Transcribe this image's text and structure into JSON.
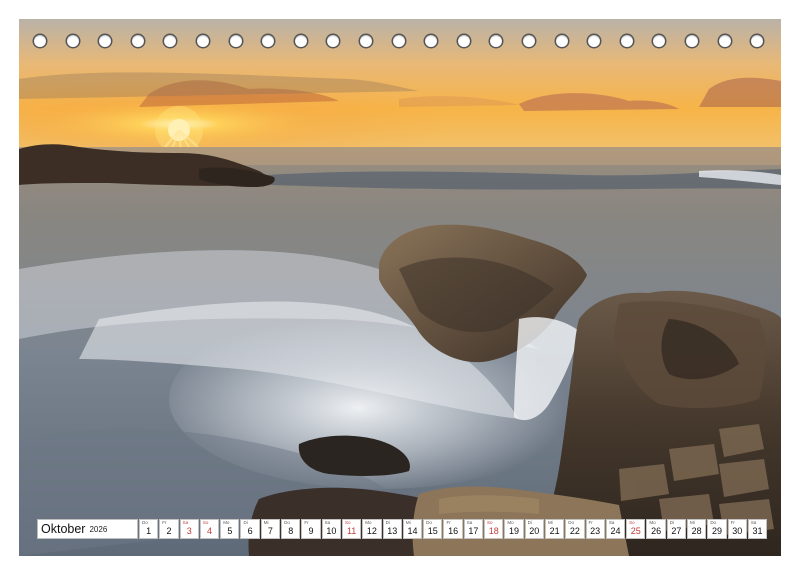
{
  "calendar": {
    "month": "Oktober",
    "year": "2026",
    "weekend_color": "#c23a3a",
    "days": [
      {
        "wd": "Do",
        "num": "1",
        "weekend": false
      },
      {
        "wd": "Fr",
        "num": "2",
        "weekend": false
      },
      {
        "wd": "Sa",
        "num": "3",
        "weekend": true
      },
      {
        "wd": "So",
        "num": "4",
        "weekend": true
      },
      {
        "wd": "Mo",
        "num": "5",
        "weekend": false
      },
      {
        "wd": "Di",
        "num": "6",
        "weekend": false
      },
      {
        "wd": "Mi",
        "num": "7",
        "weekend": false
      },
      {
        "wd": "Do",
        "num": "8",
        "weekend": false
      },
      {
        "wd": "Fr",
        "num": "9",
        "weekend": false
      },
      {
        "wd": "Sa",
        "num": "10",
        "weekend": false
      },
      {
        "wd": "So",
        "num": "11",
        "weekend": true
      },
      {
        "wd": "Mo",
        "num": "12",
        "weekend": false
      },
      {
        "wd": "Di",
        "num": "13",
        "weekend": false
      },
      {
        "wd": "Mi",
        "num": "14",
        "weekend": false
      },
      {
        "wd": "Do",
        "num": "15",
        "weekend": false
      },
      {
        "wd": "Fr",
        "num": "16",
        "weekend": false
      },
      {
        "wd": "Sa",
        "num": "17",
        "weekend": false
      },
      {
        "wd": "So",
        "num": "18",
        "weekend": true
      },
      {
        "wd": "Mo",
        "num": "19",
        "weekend": false
      },
      {
        "wd": "Di",
        "num": "20",
        "weekend": false
      },
      {
        "wd": "Mi",
        "num": "21",
        "weekend": false
      },
      {
        "wd": "Do",
        "num": "22",
        "weekend": false
      },
      {
        "wd": "Fr",
        "num": "23",
        "weekend": false
      },
      {
        "wd": "Sa",
        "num": "24",
        "weekend": false
      },
      {
        "wd": "So",
        "num": "25",
        "weekend": true
      },
      {
        "wd": "Mo",
        "num": "26",
        "weekend": false
      },
      {
        "wd": "Di",
        "num": "27",
        "weekend": false
      },
      {
        "wd": "Mi",
        "num": "28",
        "weekend": false
      },
      {
        "wd": "Do",
        "num": "29",
        "weekend": false
      },
      {
        "wd": "Fr",
        "num": "30",
        "weekend": false
      },
      {
        "wd": "Sa",
        "num": "31",
        "weekend": false
      }
    ]
  },
  "binding": {
    "ring_count": 23
  },
  "photo": {
    "subject": "coastal-sunset",
    "icon": "seascape-photo",
    "colors": {
      "sky_top": "#c9c2b3",
      "sky_glow": "#f6b93b",
      "sun": "#fff4c2",
      "sea": "#7d8794",
      "foam": "#e9edf1",
      "rock": "#4a3c30"
    }
  }
}
